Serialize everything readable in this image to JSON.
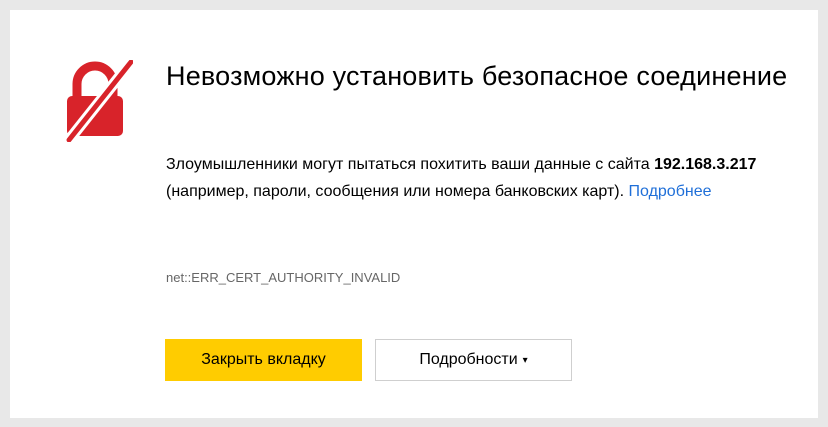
{
  "page": {
    "title": "Невозможно установить безопасное соединение",
    "description_before": "Злоумышленники могут пытаться похитить ваши данные с сайта ",
    "host": "192.168.3.217",
    "description_after": " (например, пароли, сообщения или номера банковских карт). ",
    "learn_more_link": "Подробнее",
    "error_code": "net::ERR_CERT_AUTHORITY_INVALID"
  },
  "buttons": {
    "close_tab": "Закрыть вкладку",
    "details": "Подробности",
    "details_caret": "▾"
  },
  "icons": {
    "lock": "broken-lock-icon"
  },
  "colors": {
    "lock_red": "#d8232a",
    "primary_button": "#ffcc00",
    "link": "#1f6fd8"
  }
}
